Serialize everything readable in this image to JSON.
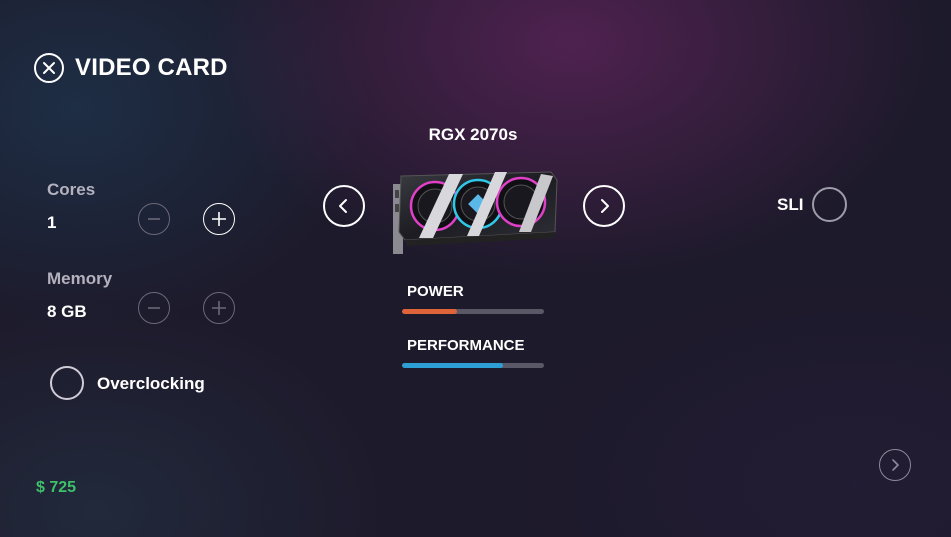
{
  "header": {
    "title": "VIDEO CARD"
  },
  "cores": {
    "label": "Cores",
    "value": "1"
  },
  "memory": {
    "label": "Memory",
    "value": "8 GB"
  },
  "overclocking": {
    "label": "Overclocking",
    "enabled": false
  },
  "card": {
    "model": "RGX 2070s"
  },
  "sli": {
    "label": "SLI",
    "enabled": false
  },
  "stats": [
    {
      "label": "POWER",
      "fraction": 0.39,
      "color": "#e0643a"
    },
    {
      "label": "PERFORMANCE",
      "fraction": 0.71,
      "color": "#2d9fd4"
    }
  ],
  "price": "$ 725"
}
